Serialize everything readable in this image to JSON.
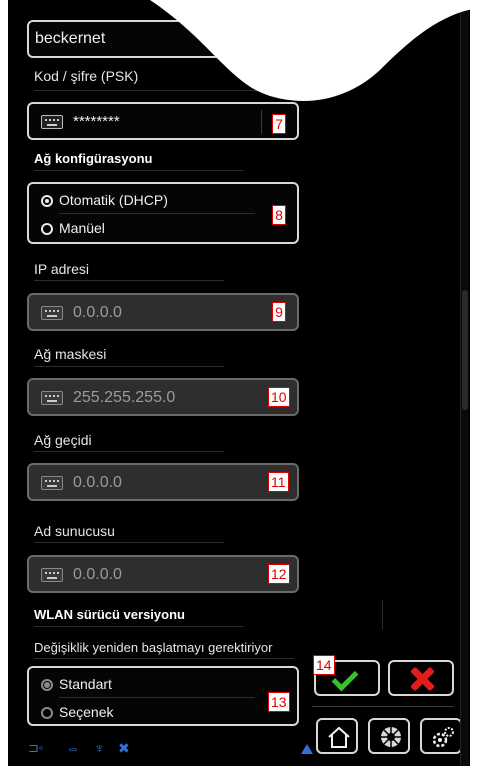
{
  "wifi": {
    "ssid_value": "beckernet",
    "psk_label": "Kod / şifre (PSK)",
    "psk_value": "********"
  },
  "network": {
    "section_title": "Ağ konfigürasyonu",
    "options": [
      "Otomatik (DHCP)",
      "Manüel"
    ],
    "selected": "Otomatik (DHCP)",
    "ip_label": "IP adresi",
    "ip_value": "0.0.0.0",
    "mask_label": "Ağ maskesi",
    "mask_value": "255.255.255.0",
    "gateway_label": "Ağ geçidi",
    "gateway_value": "0.0.0.0",
    "dns_label": "Ad sunucusu",
    "dns_value": "0.0.0.0"
  },
  "driver": {
    "section_title": "WLAN sürücü versiyonu",
    "hint": "Değişiklik yeniden başlatmayı gerektiriyor",
    "options": [
      "Standart",
      "Seçenek"
    ],
    "selected": "Standart"
  },
  "markers": {
    "psk": "7",
    "network_mode": "8",
    "ip": "9",
    "mask": "10",
    "gateway": "11",
    "dns": "12",
    "driver": "13",
    "confirm": "14"
  },
  "actions": {
    "confirm_icon": "checkmark-icon",
    "cancel_icon": "cross-icon"
  },
  "nav": {
    "icons": [
      "home-icon",
      "tool-disc-icon",
      "gears-icon"
    ]
  },
  "status_icons": [
    "network-plug-icon",
    "link-icon",
    "antenna-icon",
    "expand-icon",
    "scroll-up-icon"
  ],
  "colors": {
    "accent_ok": "#33c42a",
    "accent_cancel": "#e21b1b",
    "marker": "#e00000",
    "status_blue": "#2f6fd6"
  }
}
